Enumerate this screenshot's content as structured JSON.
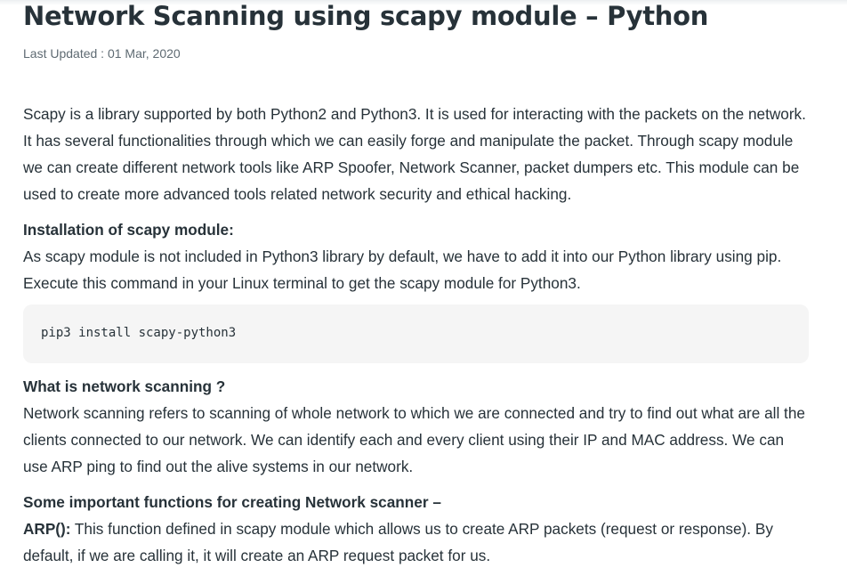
{
  "article": {
    "title": "Network Scanning using scapy module – Python",
    "last_updated": "Last Updated : 01 Mar, 2020",
    "intro": "Scapy is a library supported by both Python2 and Python3. It is used for interacting with the packets on the network. It has several functionalities through which we can easily forge and manipulate the packet. Through scapy module we can create different network tools like ARP Spoofer, Network Scanner, packet dumpers etc. This module can be used to create more advanced tools related network security and ethical hacking.",
    "installation_heading": "Installation of scapy module:",
    "installation_text": "As scapy module is not included in Python3 library by default, we have to add it into our Python library using pip. Execute this command in your Linux terminal to get the scapy module for Python3.",
    "code": "pip3 install scapy-python3",
    "scanning_heading": "What is network scanning ?",
    "scanning_text": "Network scanning refers to scanning of whole network to which we are connected and try to find out what are all the clients connected to our network. We can identify each and every client using their IP and MAC address. We can use ARP ping to find out the alive systems in our network.",
    "functions_heading": "Some important functions for creating Network scanner –",
    "arp_label": "ARP():",
    "arp_text": " This function defined in scapy module which allows us to create ARP packets (request or response). By default, if we are calling it, it will create an ARP request packet for us."
  }
}
